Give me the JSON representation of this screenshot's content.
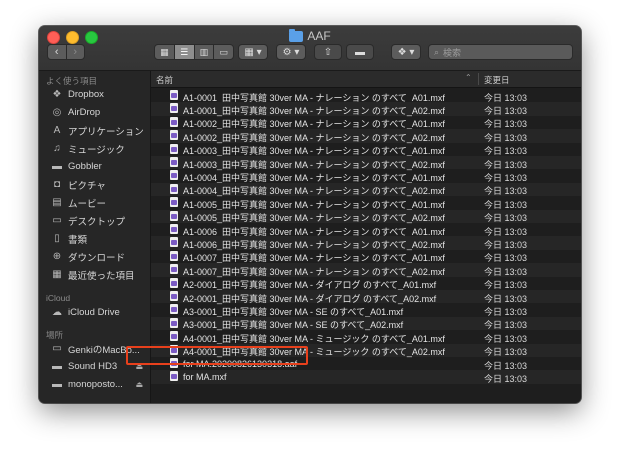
{
  "window": {
    "title": "AAF",
    "accent": "#e8401c"
  },
  "toolbar": {
    "back_icon": "chevron-left-icon",
    "forward_icon": "chevron-right-icon",
    "views": [
      "icon-view-icon",
      "list-view-icon",
      "column-view-icon",
      "gallery-view-icon"
    ],
    "search_placeholder": "検索"
  },
  "sidebar": {
    "favorites_label": "よく使う項目",
    "favorites": [
      {
        "label": "Dropbox",
        "icon": "dropbox-icon"
      },
      {
        "label": "AirDrop",
        "icon": "airdrop-icon"
      },
      {
        "label": "アプリケーション",
        "icon": "applications-icon"
      },
      {
        "label": "ミュージック",
        "icon": "music-icon"
      },
      {
        "label": "Gobbler",
        "icon": "folder-icon"
      },
      {
        "label": "ピクチャ",
        "icon": "pictures-icon"
      },
      {
        "label": "ムービー",
        "icon": "movies-icon"
      },
      {
        "label": "デスクトップ",
        "icon": "desktop-icon"
      },
      {
        "label": "書類",
        "icon": "documents-icon"
      },
      {
        "label": "ダウンロード",
        "icon": "downloads-icon"
      },
      {
        "label": "最近使った項目",
        "icon": "recents-icon"
      }
    ],
    "icloud_label": "iCloud",
    "icloud": [
      {
        "label": "iCloud Drive",
        "icon": "cloud-icon"
      }
    ],
    "locations_label": "場所",
    "locations": [
      {
        "label": "GenkiのMacBo...",
        "icon": "laptop-icon"
      },
      {
        "label": "Sound HD3",
        "icon": "disk-icon",
        "eject": "⏏"
      },
      {
        "label": "monoposto...",
        "icon": "disk-icon",
        "eject": "⏏"
      }
    ]
  },
  "list": {
    "columns": {
      "name": "名前",
      "date": "変更日"
    },
    "files": [
      {
        "name": "A1-0001_田中写真館 30ver MA - ナレーション のすべて_A01.mxf",
        "date": "今日 13:03"
      },
      {
        "name": "A1-0001_田中写真館 30ver MA - ナレーション のすべて_A02.mxf",
        "date": "今日 13:03"
      },
      {
        "name": "A1-0002_田中写真館 30ver MA - ナレーション のすべて_A01.mxf",
        "date": "今日 13:03"
      },
      {
        "name": "A1-0002_田中写真館 30ver MA - ナレーション のすべて_A02.mxf",
        "date": "今日 13:03"
      },
      {
        "name": "A1-0003_田中写真館 30ver MA - ナレーション のすべて_A01.mxf",
        "date": "今日 13:03"
      },
      {
        "name": "A1-0003_田中写真館 30ver MA - ナレーション のすべて_A02.mxf",
        "date": "今日 13:03"
      },
      {
        "name": "A1-0004_田中写真館 30ver MA - ナレーション のすべて_A01.mxf",
        "date": "今日 13:03"
      },
      {
        "name": "A1-0004_田中写真館 30ver MA - ナレーション のすべて_A02.mxf",
        "date": "今日 13:03"
      },
      {
        "name": "A1-0005_田中写真館 30ver MA - ナレーション のすべて_A01.mxf",
        "date": "今日 13:03"
      },
      {
        "name": "A1-0005_田中写真館 30ver MA - ナレーション のすべて_A02.mxf",
        "date": "今日 13:03"
      },
      {
        "name": "A1-0006_田中写真館 30ver MA - ナレーション のすべて_A01.mxf",
        "date": "今日 13:03"
      },
      {
        "name": "A1-0006_田中写真館 30ver MA - ナレーション のすべて_A02.mxf",
        "date": "今日 13:03"
      },
      {
        "name": "A1-0007_田中写真館 30ver MA - ナレーション のすべて_A01.mxf",
        "date": "今日 13:03"
      },
      {
        "name": "A1-0007_田中写真館 30ver MA - ナレーション のすべて_A02.mxf",
        "date": "今日 13:03"
      },
      {
        "name": "A2-0001_田中写真館 30ver MA - ダイアログ のすべて_A01.mxf",
        "date": "今日 13:03"
      },
      {
        "name": "A2-0001_田中写真館 30ver MA - ダイアログ のすべて_A02.mxf",
        "date": "今日 13:03"
      },
      {
        "name": "A3-0001_田中写真館 30ver MA - SE のすべて_A01.mxf",
        "date": "今日 13:03"
      },
      {
        "name": "A3-0001_田中写真館 30ver MA - SE のすべて_A02.mxf",
        "date": "今日 13:03"
      },
      {
        "name": "A4-0001_田中写真館 30ver MA - ミュージック のすべて_A01.mxf",
        "date": "今日 13:03"
      },
      {
        "name": "A4-0001_田中写真館 30ver MA - ミュージック のすべて_A02.mxf",
        "date": "今日 13:03"
      },
      {
        "name": "for MA.20200826130318.aaf",
        "date": "今日 13:03"
      },
      {
        "name": "for MA.mxf",
        "date": "今日 13:03"
      }
    ]
  }
}
